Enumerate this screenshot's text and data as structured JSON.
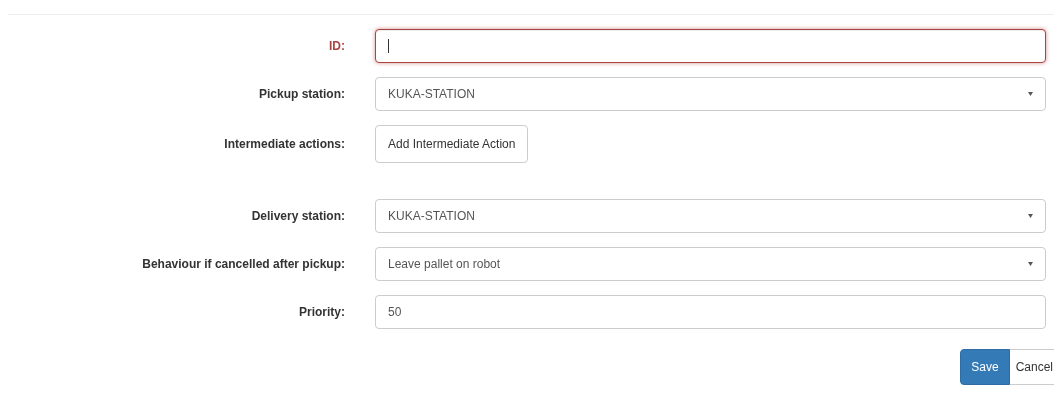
{
  "fields": [
    {
      "label": "ID:",
      "kind": "text",
      "invalid": true
    },
    {
      "label": "Pickup station:",
      "kind": "select",
      "value": "KUKA-STATION",
      "invalid": false
    },
    {
      "label": "Intermediate actions:",
      "kind": "button",
      "value": "Add Intermediate Action",
      "invalid": false
    },
    {
      "label": "Delivery station:",
      "kind": "select",
      "value": "KUKA-STATION",
      "invalid": false
    },
    {
      "label": "Behaviour if cancelled after pickup:",
      "kind": "select",
      "value": "Leave pallet on robot",
      "invalid": false
    },
    {
      "label": "Priority:",
      "kind": "text",
      "value": "50",
      "invalid": false
    }
  ],
  "buttons": [
    {
      "label": "Save",
      "kind": "primary"
    },
    {
      "label": "Cancel",
      "kind": "default"
    }
  ]
}
